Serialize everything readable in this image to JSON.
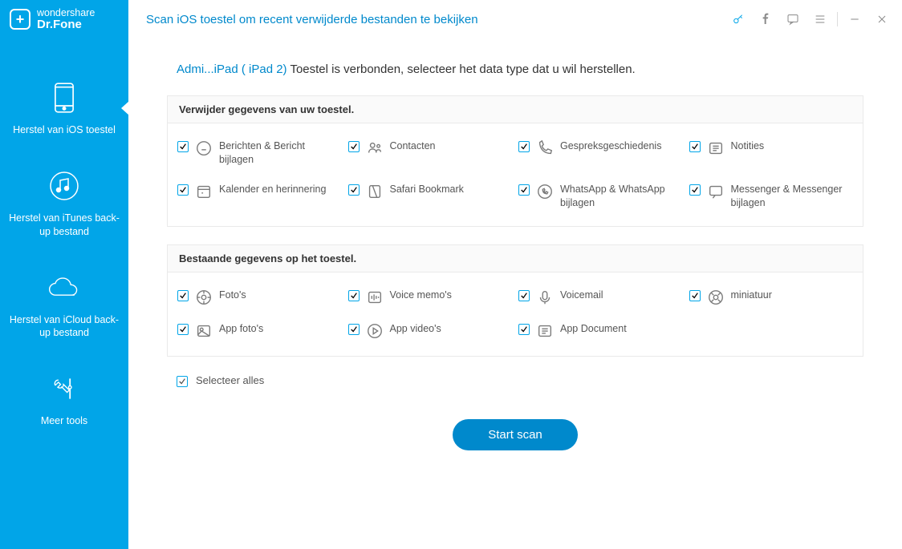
{
  "brand": {
    "top": "wondershare",
    "name": "Dr.Fone"
  },
  "title": "Scan iOS toestel om recent verwijderde bestanden te bekijken",
  "sidebar": {
    "items": [
      {
        "label": "Herstel van iOS toestel"
      },
      {
        "label": "Herstel van iTunes back-up bestand"
      },
      {
        "label": "Herstel van iCloud back-up bestand"
      },
      {
        "label": "Meer tools"
      }
    ]
  },
  "device": {
    "name": "Admi...iPad ( iPad 2)",
    "message": " Toestel is verbonden, selecteer het data type dat u wil herstellen."
  },
  "panels": {
    "deleted": {
      "header": "Verwijder gegevens van uw toestel.",
      "r0": {
        "c0": "Berichten & Bericht bijlagen",
        "c1": "Contacten",
        "c2": "Gespreksgeschiedenis",
        "c3": "Notities"
      },
      "r1": {
        "c0": "Kalender en herinnering",
        "c1": "Safari Bookmark",
        "c2": "WhatsApp & WhatsApp bijlagen",
        "c3": "Messenger & Messenger bijlagen"
      }
    },
    "existing": {
      "header": "Bestaande gegevens op het toestel.",
      "r0": {
        "c0": "Foto's",
        "c1": "Voice memo's",
        "c2": "Voicemail",
        "c3": "miniatuur"
      },
      "r1": {
        "c0": "App foto's",
        "c1": "App video's",
        "c2": "App Document"
      }
    }
  },
  "selectAll": "Selecteer alles",
  "startScan": "Start scan"
}
